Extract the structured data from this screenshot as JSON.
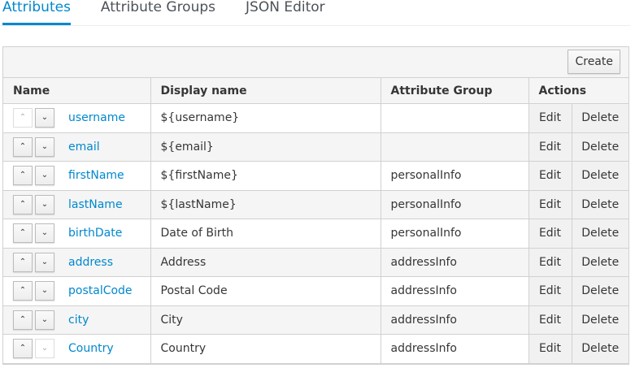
{
  "tabs": [
    {
      "label": "Attributes",
      "active": true
    },
    {
      "label": "Attribute Groups"
    },
    {
      "label": "JSON Editor"
    }
  ],
  "toolbar": {
    "create_label": "Create"
  },
  "columns": {
    "name": "Name",
    "display": "Display name",
    "group": "Attribute Group",
    "actions": "Actions"
  },
  "actions": {
    "edit": "Edit",
    "delete": "Delete"
  },
  "rows": [
    {
      "name": "username",
      "display": "${username}",
      "group": ""
    },
    {
      "name": "email",
      "display": "${email}",
      "group": ""
    },
    {
      "name": "firstName",
      "display": "${firstName}",
      "group": "personalInfo"
    },
    {
      "name": "lastName",
      "display": "${lastName}",
      "group": "personalInfo"
    },
    {
      "name": "birthDate",
      "display": "Date of Birth",
      "group": "personalInfo"
    },
    {
      "name": "address",
      "display": "Address",
      "group": "addressInfo"
    },
    {
      "name": "postalCode",
      "display": "Postal Code",
      "group": "addressInfo"
    },
    {
      "name": "city",
      "display": "City",
      "group": "addressInfo"
    },
    {
      "name": "Country",
      "display": "Country",
      "group": "addressInfo"
    }
  ],
  "colors": {
    "accent": "#0088ce"
  },
  "icons": {
    "up": "chevron-up-icon",
    "down": "chevron-down-icon"
  }
}
